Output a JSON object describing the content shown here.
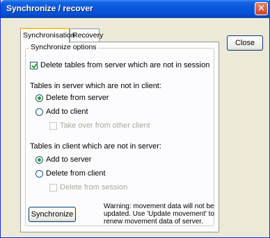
{
  "window": {
    "title": "Synchronize / recover",
    "close_glyph": "✕"
  },
  "buttons": {
    "close": "Close",
    "synchronize": "Synchronize"
  },
  "tabs": [
    {
      "label": "Synchronisation",
      "active": true
    },
    {
      "label": "Recovery",
      "active": false
    }
  ],
  "options": {
    "group_label": "Synchronize options",
    "delete_tables_server": {
      "label": "Delete tables from server which are not in session",
      "checked": true
    },
    "server_not_client_heading": "Tables in server which are not in client:",
    "delete_from_server": {
      "label": "Delete from server",
      "checked": true
    },
    "add_to_client": {
      "label": "Add to client",
      "checked": false
    },
    "take_over_other_client": {
      "label": "Take over from other client",
      "checked": false,
      "enabled": false
    },
    "client_not_server_heading": "Tables in client which are not in server:",
    "add_to_server": {
      "label": "Add to server",
      "checked": true
    },
    "delete_from_client": {
      "label": "Delete from client",
      "checked": false
    },
    "delete_from_session": {
      "label": "Delete from session",
      "checked": false,
      "enabled": false
    }
  },
  "warning_text": "Warning: movement data will not be updated. Use 'Update movement' to renew movement data of server."
}
